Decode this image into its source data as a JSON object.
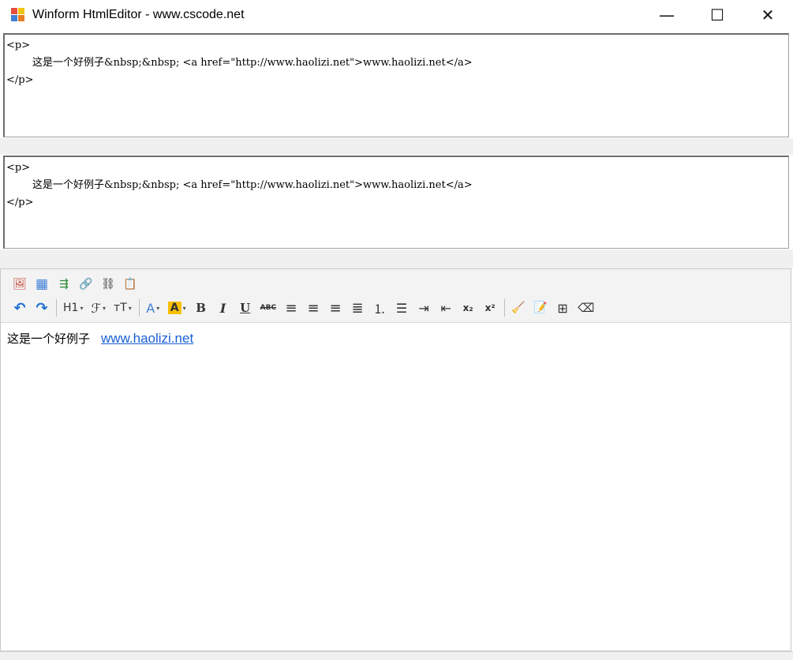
{
  "window": {
    "title": "Winform HtmlEditor - www.cscode.net",
    "minimize_glyph": "—",
    "maximize_glyph": "☐",
    "close_glyph": "✕"
  },
  "source_panel_1": {
    "lines": [
      "<p>",
      "        这是一个好例子&nbsp;&nbsp; <a href=\"http://www.haolizi.net\">www.haolizi.net</a>",
      "</p>"
    ]
  },
  "source_panel_2": {
    "lines": [
      "<p>",
      "        这是一个好例子&nbsp;&nbsp; <a href=\"http://www.haolizi.net\">www.haolizi.net</a>",
      "</p>"
    ]
  },
  "toolbar": {
    "row1": [
      {
        "name": "insert-image-icon",
        "glyph": "🖼"
      },
      {
        "name": "insert-table-icon",
        "glyph": "▦"
      },
      {
        "name": "insert-horizontal-rule-icon",
        "glyph": "⇶"
      },
      {
        "name": "insert-link-icon",
        "glyph": "🔗"
      },
      {
        "name": "remove-link-icon",
        "glyph": "⛓"
      },
      {
        "name": "paste-icon",
        "glyph": "📋"
      }
    ],
    "undo_glyph": "↶",
    "redo_glyph": "↷",
    "heading_label": "H1",
    "font_family_glyph": "ℱ",
    "font_size_label": "тT",
    "font_color_label": "A",
    "highlight_label": "A",
    "bold_label": "B",
    "italic_label": "I",
    "underline_label": "U",
    "strikethrough_label": "ABC",
    "align_left_glyph": "≡",
    "align_center_glyph": "≡",
    "align_right_glyph": "≡",
    "justify_glyph": "≣",
    "ordered_list_glyph": "⒈",
    "unordered_list_glyph": "☰",
    "indent_glyph": "⇥",
    "outdent_glyph": "⇤",
    "subscript_label": "x₂",
    "superscript_label": "x²",
    "clean_glyph": "🧹",
    "edit_source_glyph": "📝",
    "grid_glyph": "⊞",
    "eraser_glyph": "⌫"
  },
  "editor": {
    "text": "这是一个好例子",
    "link_text": "www.haolizi.net"
  },
  "colors": {
    "link": "#1a5fd6",
    "highlight": "#f8c000",
    "font_color": "#3b7fd4"
  }
}
